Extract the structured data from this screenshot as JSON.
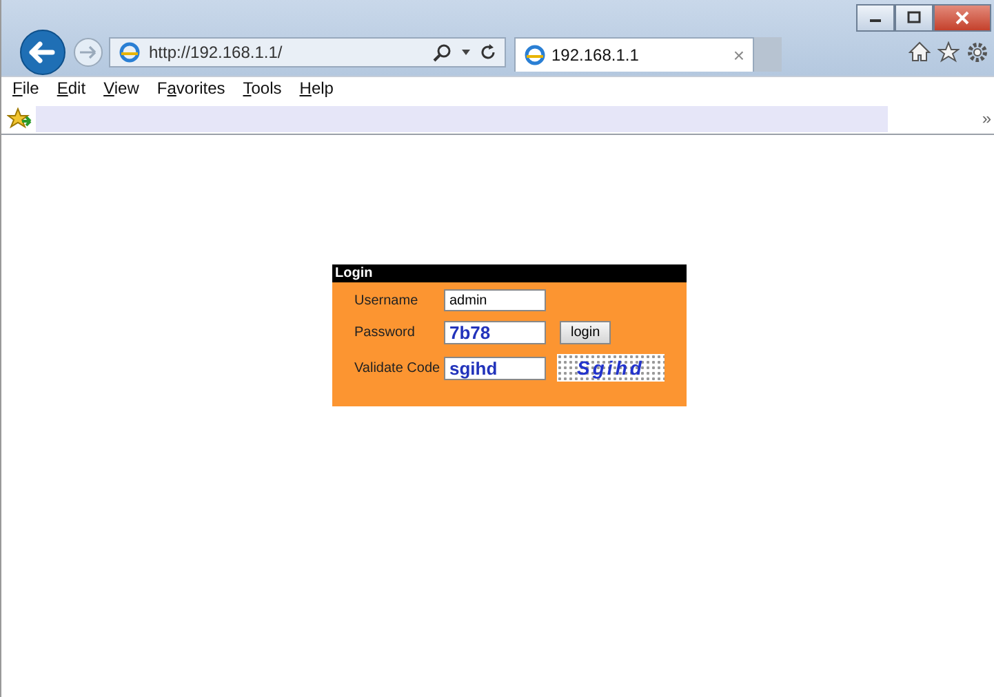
{
  "browser": {
    "address": "http://192.168.1.1/",
    "tab": {
      "title": "192.168.1.1",
      "close": "×"
    }
  },
  "menu": [
    {
      "key": "F",
      "post": "ile"
    },
    {
      "key": "E",
      "post": "dit"
    },
    {
      "key": "V",
      "post": "iew"
    },
    {
      "pre": "F",
      "key": "a",
      "post": "vorites"
    },
    {
      "key": "T",
      "post": "ools"
    },
    {
      "key": "H",
      "post": "elp"
    }
  ],
  "favorites_bar": {
    "chevron": "»"
  },
  "login": {
    "title": "Login",
    "fields": [
      {
        "label": "Username",
        "value": "admin",
        "kind": "plain"
      },
      {
        "label": "Password",
        "value": "7b78",
        "kind": "bold"
      },
      {
        "label": "Validate Code",
        "value": "sgihd",
        "kind": "bold"
      }
    ],
    "button": "login",
    "captcha": "Sgihd"
  }
}
